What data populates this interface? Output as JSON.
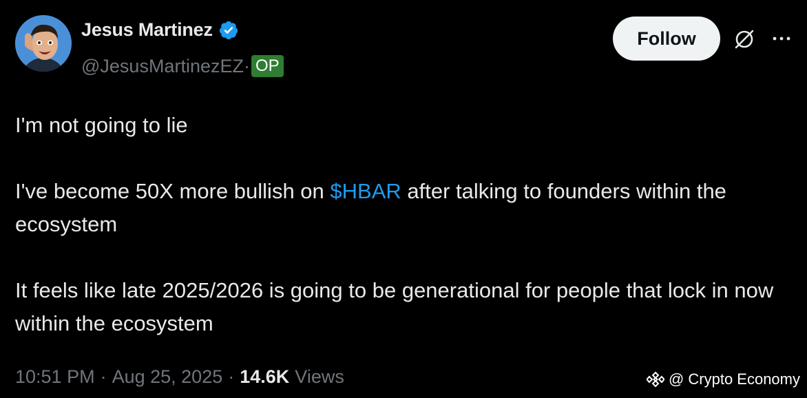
{
  "author": {
    "display_name": "Jesus Martinez",
    "handle": "@JesusMartinezEZ",
    "handle_separator": "·",
    "op_badge": "OP"
  },
  "actions": {
    "follow_label": "Follow"
  },
  "tweet": {
    "line1": "I'm not going to lie",
    "line2_before": "I've become 50X more bullish on ",
    "cashtag": "$HBAR",
    "line2_after": " after talking to founders within the ecosystem",
    "line3": "It feels like late 2025/2026 is going to be generational for people that lock in now within the ecosystem"
  },
  "meta": {
    "time": "10:51 PM",
    "date": "Aug 25, 2025",
    "separator": "·",
    "views_count": "14.6K",
    "views_label": "Views"
  },
  "watermark": {
    "text": "@ Crypto Economy"
  },
  "colors": {
    "background": "#000000",
    "text": "#e7e9ea",
    "muted": "#71767b",
    "link": "#1d9bf0",
    "verified": "#1d9bf0",
    "op_badge": "#2e7d32",
    "follow_bg": "#eff3f4"
  },
  "icons": {
    "verified": "verified-badge-icon",
    "grok": "grok-icon",
    "more": "more-dots-icon",
    "watermark": "binance-diamond-icon"
  }
}
